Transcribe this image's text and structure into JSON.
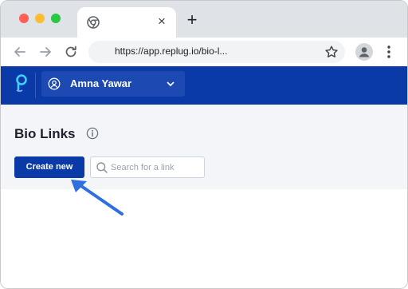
{
  "browser": {
    "tab": {
      "favicon": "chrome-icon",
      "close_label": "×"
    },
    "new_tab_label": "+",
    "toolbar": {
      "url": "https://app.replug.io/bio-l...",
      "icons": [
        "back-arrow-icon",
        "forward-arrow-icon",
        "reload-icon",
        "star-icon",
        "profile-icon",
        "menu-dots-icon"
      ]
    }
  },
  "app_header": {
    "logo": "replug-logo",
    "workspace": {
      "name": "Amna Yawar",
      "icon": "user-icon",
      "dropdown_icon": "chevron-down-icon"
    },
    "color": "#0a3aa8"
  },
  "page": {
    "title": "Bio Links",
    "info_icon": "info-icon",
    "create_button": "Create new",
    "search": {
      "placeholder": "Search for a link",
      "value": ""
    }
  },
  "annotation": {
    "arrow_color": "#2f6fe0",
    "points_to": "create-new-button"
  }
}
